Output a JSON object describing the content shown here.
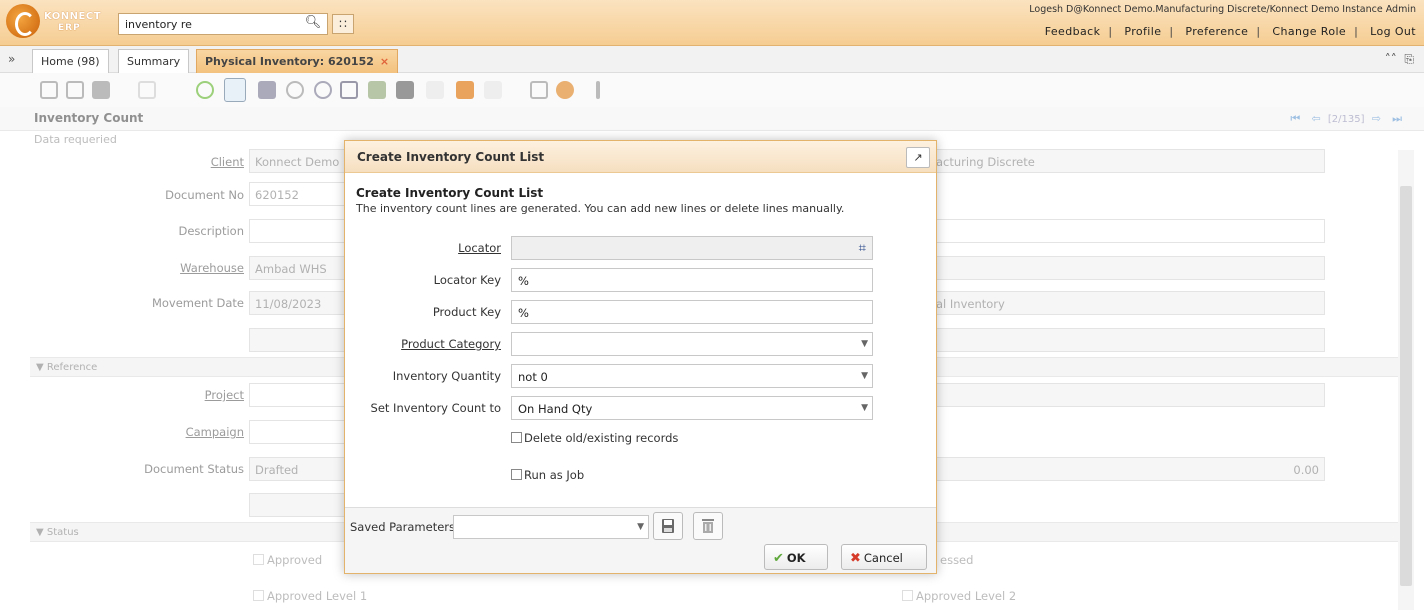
{
  "header": {
    "logo_line1": "KONNECT",
    "logo_line2": "ERP",
    "search_value": "inventory re",
    "user_info": "Logesh D@Konnect Demo.Manufacturing Discrete/Konnect Demo Instance Admin",
    "links": [
      "Feedback",
      "Profile",
      "Preference",
      "Change Role",
      "Log Out"
    ]
  },
  "tabs": {
    "items": [
      {
        "label": "Home (98)"
      },
      {
        "label": "Summary"
      },
      {
        "label": "Physical Inventory: 620152",
        "close": "×"
      }
    ]
  },
  "window": {
    "title": "Inventory Count",
    "record_info": "[2/135]",
    "data_required": "Data requeried"
  },
  "form": {
    "client_label": "Client",
    "client_value": "Konnect Demo",
    "org_value": "acturing Discrete",
    "document_no_label": "Document No",
    "document_no_value": "620152",
    "description_label": "Description",
    "warehouse_label": "Warehouse",
    "warehouse_value": "Ambad WHS",
    "movement_date_label": "Movement Date",
    "movement_date_value": "11/08/2023",
    "doc_type_value": "al Inventory",
    "reference_section": "Reference",
    "project_label": "Project",
    "campaign_label": "Campaign",
    "document_status_label": "Document Status",
    "document_status_value": "Drafted",
    "amount_value": "0.00",
    "status_section": "Status",
    "approved_label": "Approved",
    "processed_label": "essed",
    "approved_level1_label": "Approved Level 1",
    "approved_level2_label": "Approved Level 2"
  },
  "dialog": {
    "title": "Create Inventory Count List",
    "heading": "Create Inventory Count List",
    "description": "The inventory count lines are generated. You can add new lines or delete lines manually.",
    "params": {
      "locator_label": "Locator",
      "locator_value": "",
      "locator_key_label": "Locator Key",
      "locator_key_value": "%",
      "product_key_label": "Product Key",
      "product_key_value": "%",
      "product_category_label": "Product Category",
      "product_category_value": "",
      "inventory_quantity_label": "Inventory Quantity",
      "inventory_quantity_value": "not 0",
      "set_count_label": "Set Inventory Count to",
      "set_count_value": "On Hand Qty",
      "delete_old_label": "Delete old/existing records",
      "run_as_job_label": "Run as Job"
    },
    "saved_parameters_label": "Saved Parameters",
    "ok_label": "OK",
    "cancel_label": "Cancel"
  },
  "colors": {
    "header_orange": "#f5cd92",
    "dialog_border": "#e3b36c",
    "ok_green": "#5fa83b",
    "cancel_red": "#d63b2a"
  }
}
